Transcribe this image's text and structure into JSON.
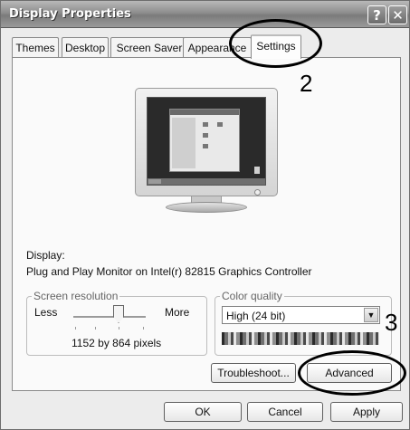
{
  "window": {
    "title": "Display Properties"
  },
  "title_buttons": {
    "help_glyph": "?",
    "close_glyph": "✕"
  },
  "tabs": [
    {
      "label": "Themes"
    },
    {
      "label": "Desktop"
    },
    {
      "label": "Screen Saver"
    },
    {
      "label": "Appearance"
    },
    {
      "label": "Settings",
      "selected": true
    }
  ],
  "annotations": {
    "callout_2": "2",
    "callout_3": "3"
  },
  "display": {
    "label": "Display:",
    "device": "Plug and Play Monitor on Intel(r) 82815 Graphics Controller"
  },
  "screen_resolution": {
    "legend": "Screen resolution",
    "less_label": "Less",
    "more_label": "More",
    "value": "1152 by 864 pixels"
  },
  "color_quality": {
    "legend": "Color quality",
    "selected": "High (24 bit)",
    "arrow_icon": "chevron-down-icon"
  },
  "buttons": {
    "troubleshoot": "Troubleshoot...",
    "advanced": "Advanced",
    "ok": "OK",
    "cancel": "Cancel",
    "apply": "Apply"
  }
}
